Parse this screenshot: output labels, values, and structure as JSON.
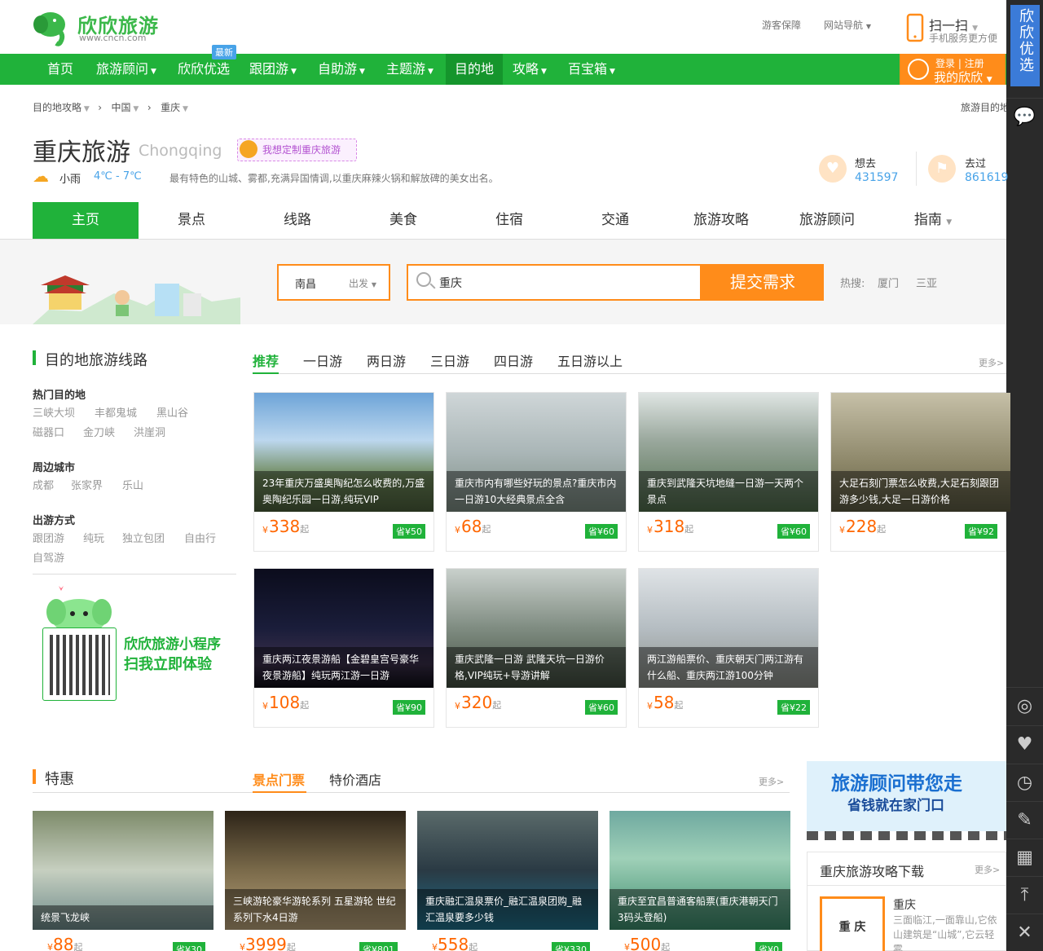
{
  "brand": {
    "logo_text": "欣欣旅游",
    "url": "www.cncn.com"
  },
  "toplinks": {
    "guarantee": "游客保障",
    "sitenav": "网站导航"
  },
  "scan": {
    "title": "扫一扫",
    "subtitle": "手机服务更方便"
  },
  "nav": {
    "items": [
      {
        "label": "首页"
      },
      {
        "label": "旅游顾问"
      },
      {
        "label": "欣欣优选"
      },
      {
        "label": "跟团游"
      },
      {
        "label": "自助游"
      },
      {
        "label": "主题游"
      },
      {
        "label": "目的地"
      },
      {
        "label": "攻略"
      },
      {
        "label": "百宝箱"
      }
    ],
    "new_badge": "最新"
  },
  "login": {
    "top": "登录 | 注册",
    "bottom": "我的欣欣"
  },
  "sidebar": {
    "promo": "欣欣优选",
    "icons": [
      "wechat-icon",
      "user-icon",
      "heart-icon",
      "clock-icon",
      "pencil-icon",
      "qrcode-icon",
      "top-arrow-icon",
      "close-icon"
    ]
  },
  "breadcrumb": {
    "items": [
      "目的地攻略",
      "中国",
      "重庆"
    ],
    "right": "旅游目的地"
  },
  "dest": {
    "title": "重庆旅游",
    "en": "Chongqing",
    "custom": "我想定制重庆旅游",
    "weather": "小雨",
    "temp": "4℃ - 7℃",
    "desc": "最有特色的山城、雾都,充满异国情调,以重庆麻辣火锅和解放碑的美女出名。",
    "want_label": "想去",
    "want_count": "431597",
    "been_label": "去过",
    "been_count": "861619"
  },
  "tabs": [
    "主页",
    "景点",
    "线路",
    "美食",
    "住宿",
    "交通",
    "旅游攻略",
    "旅游顾问",
    "指南"
  ],
  "search": {
    "city": "南昌",
    "depart": "出发",
    "value": "重庆",
    "submit": "提交需求",
    "hot_label": "热搜:",
    "hot": [
      "厦门",
      "三亚"
    ]
  },
  "routes": {
    "title": "目的地旅游线路",
    "subtabs": [
      "推荐",
      "一日游",
      "两日游",
      "三日游",
      "四日游",
      "五日游以上"
    ],
    "more": "更多>",
    "groups": [
      {
        "heading": "热门目的地",
        "links": [
          "三峡大坝",
          "丰都鬼城",
          "黑山谷",
          "磁器口",
          "金刀峡",
          "洪崖洞"
        ]
      },
      {
        "heading": "周边城市",
        "links": [
          "成都",
          "张家界",
          "乐山"
        ]
      },
      {
        "heading": "出游方式",
        "links": [
          "跟团游",
          "纯玩",
          "独立包团",
          "自由行",
          "自驾游"
        ]
      }
    ],
    "cards": [
      {
        "cap": "23年重庆万盛奥陶纪怎么收费的,万盛奥陶纪乐园一日游,纯玩VIP",
        "price": "338",
        "save": "省¥50"
      },
      {
        "cap": "重庆市内有哪些好玩的景点?重庆市内一日游10大经典景点全含",
        "price": "68",
        "save": "省¥60"
      },
      {
        "cap": "重庆到武隆天坑地缝一日游一天两个景点",
        "price": "318",
        "save": "省¥60"
      },
      {
        "cap": "大足石刻门票怎么收费,大足石刻跟团游多少钱,大足一日游价格",
        "price": "228",
        "save": "省¥92"
      },
      {
        "cap": "重庆两江夜景游船【金碧皇宫号豪华夜景游船】纯玩两江游一日游",
        "price": "108",
        "save": "省¥90"
      },
      {
        "cap": "重庆武隆一日游 武隆天坑一日游价格,VIP纯玩+导游讲解",
        "price": "320",
        "save": "省¥60"
      },
      {
        "cap": "两江游船票价、重庆朝天门两江游有什么船、重庆两江游100分钟",
        "price": "58",
        "save": "省¥22"
      }
    ],
    "yen": "¥",
    "qi": "起"
  },
  "miniapp": {
    "line1": "欣欣旅游小程序",
    "line2": "扫我立即体验"
  },
  "deals": {
    "title": "特惠",
    "subtabs": [
      "景点门票",
      "特价酒店"
    ],
    "more": "更多>",
    "cards": [
      {
        "cap": "统景飞龙峡",
        "price": "88",
        "save": "省¥30"
      },
      {
        "cap": "三峡游轮豪华游轮系列 五星游轮 世纪系列下水4日游",
        "price": "3999",
        "save": "省¥801"
      },
      {
        "cap": "重庆融汇温泉票价_融汇温泉团购_融汇温泉要多少钱",
        "price": "558",
        "save": "省¥330"
      },
      {
        "cap": "重庆至宜昌普通客船票(重庆港朝天门3码头登船)",
        "price": "500",
        "save": "省¥0"
      }
    ]
  },
  "ad": {
    "line1": "旅游顾问带您走",
    "line2": "省钱就在家门口"
  },
  "download": {
    "title": "重庆旅游攻略下载",
    "more": "更多>",
    "book": "重 庆",
    "name": "重庆",
    "desc": "三面临江,一面靠山,它依山建筑是“山城”,它云轻雾"
  },
  "colors": {
    "green": "#20b23a",
    "orange": "#ff8c1a",
    "blue": "#48a3e8",
    "price": "#ff6600"
  }
}
